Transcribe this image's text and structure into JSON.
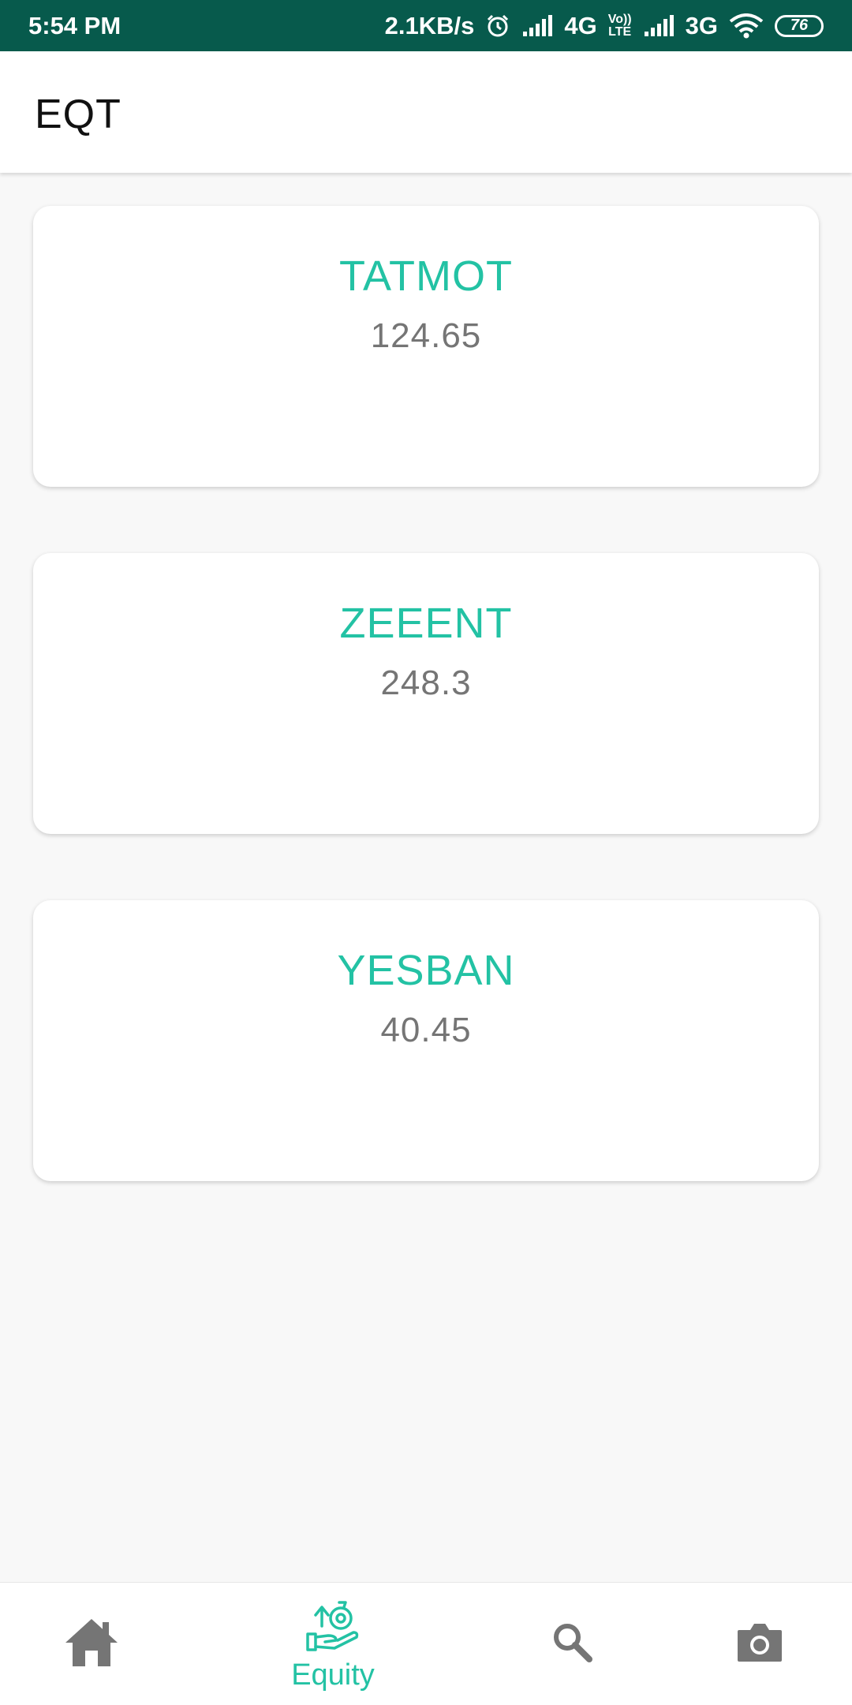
{
  "status_bar": {
    "time": "5:54 PM",
    "network_speed": "2.1KB/s",
    "sim1_type": "4G",
    "volte_top": "Vo))",
    "volte_bottom": "LTE",
    "sim2_type": "3G",
    "battery_level": "76"
  },
  "app_bar": {
    "title": "EQT"
  },
  "stocks": [
    {
      "symbol": "TATMOT",
      "price": "124.65"
    },
    {
      "symbol": "ZEEENT",
      "price": "248.3"
    },
    {
      "symbol": "YESBAN",
      "price": "40.45"
    }
  ],
  "bottom_nav": {
    "items": [
      {
        "icon": "home-icon",
        "label": "",
        "active": false
      },
      {
        "icon": "equity-icon",
        "label": "Equity",
        "active": true
      },
      {
        "icon": "search-icon",
        "label": "",
        "active": false
      },
      {
        "icon": "camera-icon",
        "label": "",
        "active": false
      }
    ]
  },
  "colors": {
    "status_bar": "#075a4c",
    "accent": "#23c2a4",
    "icon_inactive": "#757575",
    "price_text": "#757575"
  }
}
